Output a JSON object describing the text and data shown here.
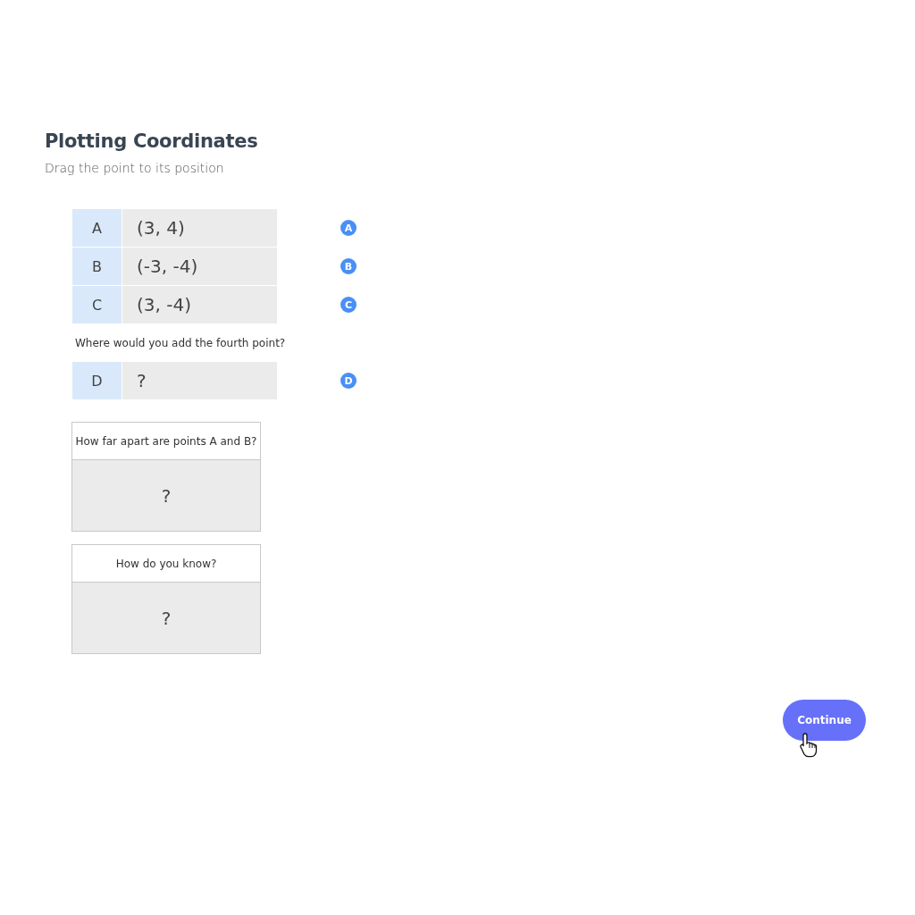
{
  "title": "Plotting Coordinates",
  "subtitle": "Drag the point to its position",
  "points": [
    {
      "label": "A",
      "value": "(3, 4)",
      "marker": "A"
    },
    {
      "label": "B",
      "value": "(-3, -4)",
      "marker": "B"
    },
    {
      "label": "C",
      "value": "(3, -4)",
      "marker": "C"
    }
  ],
  "question": "Where would you add the fourth point?",
  "fourth_point": {
    "label": "D",
    "value": "?",
    "marker": "D"
  },
  "cards": [
    {
      "question": "How far apart are points A and B?",
      "answer": "?"
    },
    {
      "question": "How do you know?",
      "answer": "?"
    }
  ],
  "continue_button": "Continue"
}
